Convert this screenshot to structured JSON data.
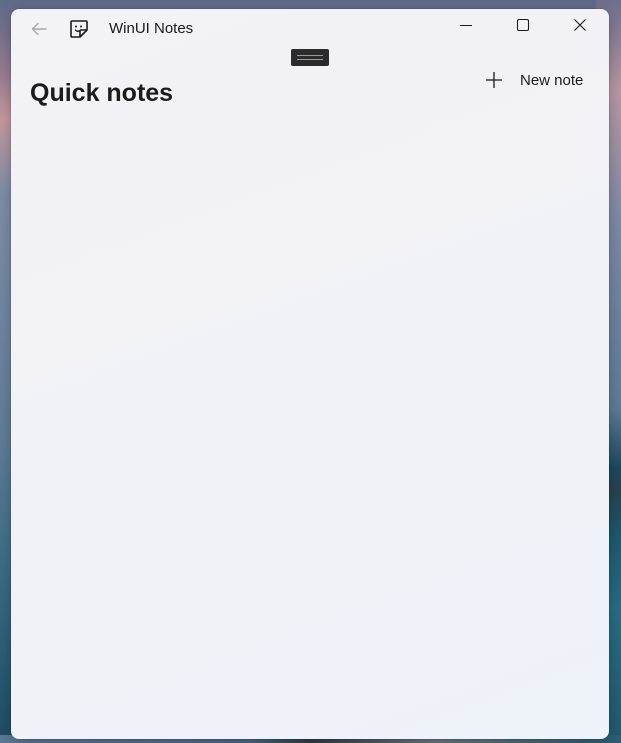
{
  "window": {
    "title": "WinUI Notes"
  },
  "page": {
    "title": "Quick notes"
  },
  "toolbar": {
    "new_note_label": "New note"
  },
  "icons": {
    "back": "back-arrow-icon",
    "app": "sticky-note-icon",
    "minimize": "minimize-icon",
    "maximize": "maximize-icon",
    "close": "close-icon",
    "add": "plus-icon"
  },
  "notes": [],
  "colors": {
    "window_background": "#f2f2f7",
    "text": "#1b1b1b",
    "disabled_icon": "#a8a8ad"
  }
}
